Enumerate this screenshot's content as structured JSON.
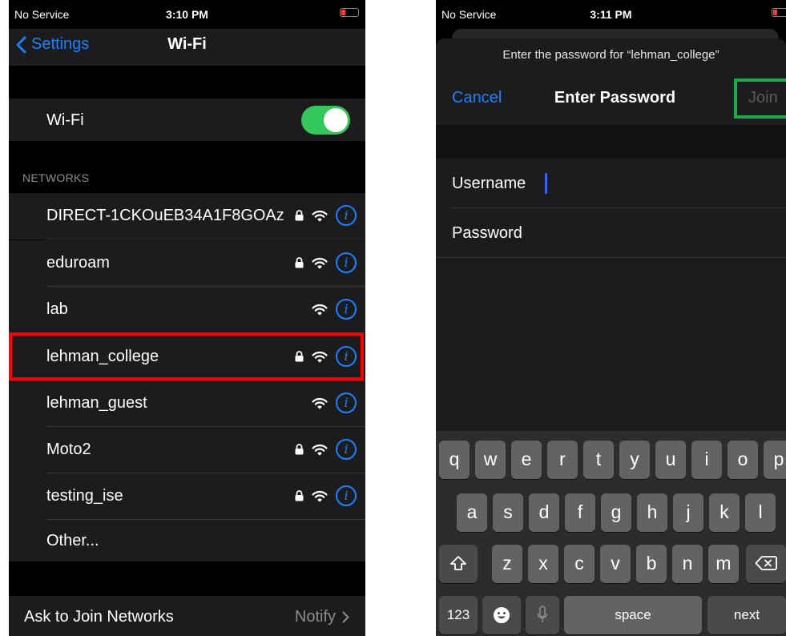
{
  "left": {
    "status": {
      "carrier": "No Service",
      "time": "3:10 PM"
    },
    "nav": {
      "back": "Settings",
      "title": "Wi-Fi"
    },
    "wifi_toggle": {
      "label": "Wi-Fi",
      "on": true
    },
    "networks_header": "NETWORKS",
    "networks": [
      {
        "name": "DIRECT-1CKOuEB34A1F8GOAz",
        "secure": true
      },
      {
        "name": "eduroam",
        "secure": true
      },
      {
        "name": "lab",
        "secure": false
      },
      {
        "name": "lehman_college",
        "secure": true
      },
      {
        "name": "lehman_guest",
        "secure": false
      },
      {
        "name": "Moto2",
        "secure": true
      },
      {
        "name": "testing_ise",
        "secure": true
      }
    ],
    "other": "Other...",
    "ask": {
      "label": "Ask to Join Networks",
      "value": "Notify"
    },
    "highlighted_network": "lehman_college"
  },
  "right": {
    "status": {
      "carrier": "No Service",
      "time": "3:11 PM"
    },
    "prompt": "Enter the password for “lehman_college”",
    "cancel": "Cancel",
    "title": "Enter Password",
    "join": "Join",
    "fields": {
      "username_label": "Username",
      "password_label": "Password"
    },
    "keyboard": {
      "row1": [
        "q",
        "w",
        "e",
        "r",
        "t",
        "y",
        "u",
        "i",
        "o",
        "p"
      ],
      "row2": [
        "a",
        "s",
        "d",
        "f",
        "g",
        "h",
        "j",
        "k",
        "l"
      ],
      "row3": [
        "z",
        "x",
        "c",
        "v",
        "b",
        "n",
        "m"
      ],
      "numbers": "123",
      "space": "space",
      "next": "next"
    }
  },
  "colors": {
    "accent": "#1a82ff",
    "toggle_on": "#34c759",
    "highlight_red": "#ff0000",
    "highlight_green": "#1fa84a"
  }
}
